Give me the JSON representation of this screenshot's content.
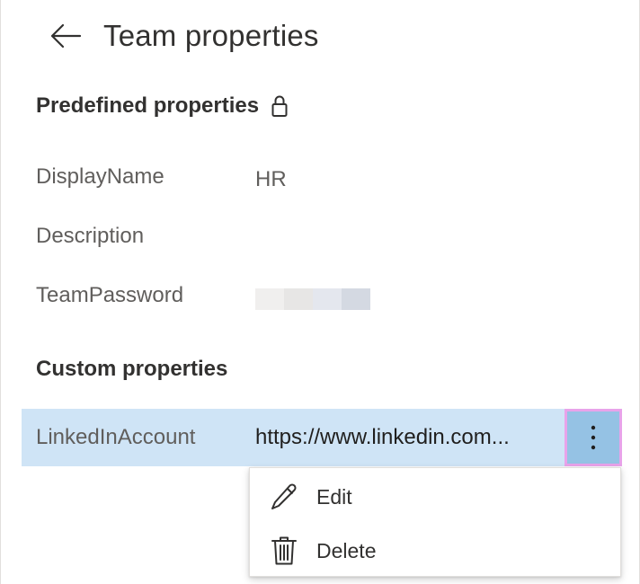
{
  "header": {
    "title": "Team properties",
    "back_icon": "arrow-left-icon"
  },
  "predefined": {
    "title": "Predefined properties",
    "lock_icon": "lock-icon",
    "rows": [
      {
        "label": "DisplayName",
        "value": "HR"
      },
      {
        "label": "Description",
        "value": ""
      },
      {
        "label": "TeamPassword",
        "value": ""
      }
    ]
  },
  "custom": {
    "title": "Custom properties",
    "rows": [
      {
        "label": "LinkedInAccount",
        "value": "https://www.linkedin.com..."
      }
    ],
    "more_icon": "more-vertical-icon"
  },
  "context_menu": {
    "items": [
      {
        "label": "Edit",
        "icon": "pencil-icon"
      },
      {
        "label": "Delete",
        "icon": "trash-icon"
      }
    ]
  },
  "colors": {
    "selected_row": "#cfe4f6",
    "more_button": "#95c2e4",
    "focus_outline": "#e8a3ea",
    "text_primary": "#323130",
    "text_secondary": "#605e5c"
  }
}
